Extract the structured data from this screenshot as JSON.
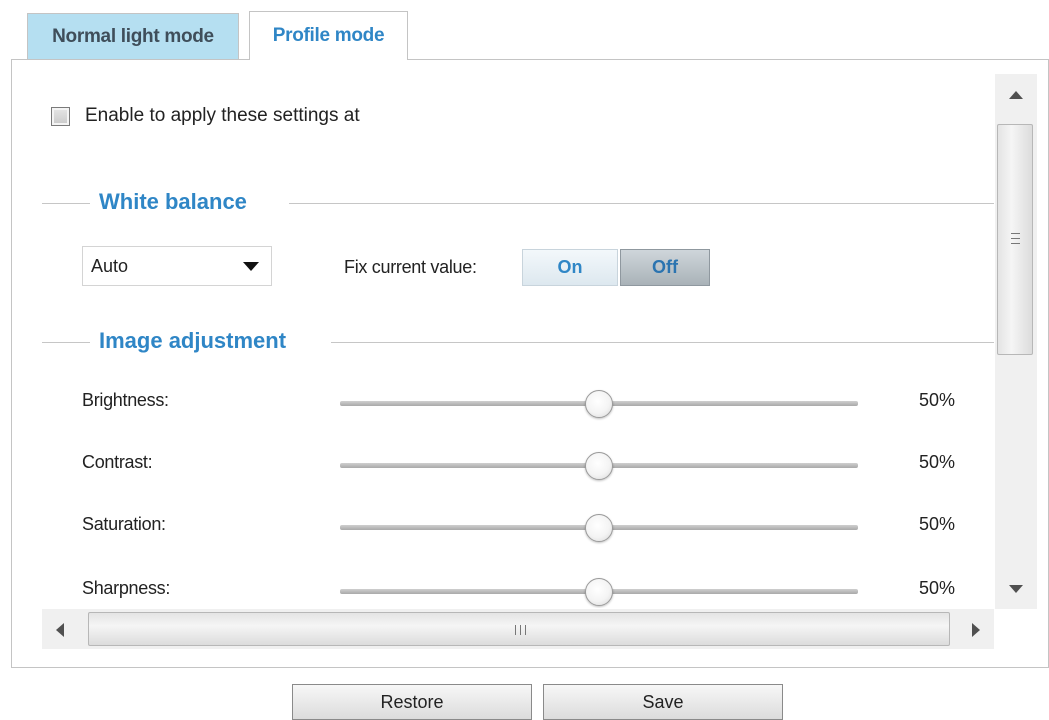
{
  "tabs": [
    {
      "label": "Normal light mode",
      "active": false
    },
    {
      "label": "Profile mode",
      "active": true
    }
  ],
  "enable": {
    "label": "Enable to apply these settings at",
    "checked": false
  },
  "white_balance": {
    "title": "White balance",
    "mode": "Auto",
    "fix_label": "Fix current value:",
    "on_label": "On",
    "off_label": "Off",
    "fix_selected": "Off"
  },
  "image_adjustment": {
    "title": "Image adjustment",
    "sliders": [
      {
        "label": "Brightness:",
        "value_text": "50%",
        "value": 0.5
      },
      {
        "label": "Contrast:",
        "value_text": "50%",
        "value": 0.5
      },
      {
        "label": "Saturation:",
        "value_text": "50%",
        "value": 0.5
      },
      {
        "label": "Sharpness:",
        "value_text": "50%",
        "value": 0.5
      }
    ]
  },
  "buttons": {
    "restore": "Restore",
    "save": "Save"
  },
  "colors": {
    "accent": "#2f86c6",
    "inactive_tab": "#b5dff1",
    "border": "#c4c4c4"
  }
}
